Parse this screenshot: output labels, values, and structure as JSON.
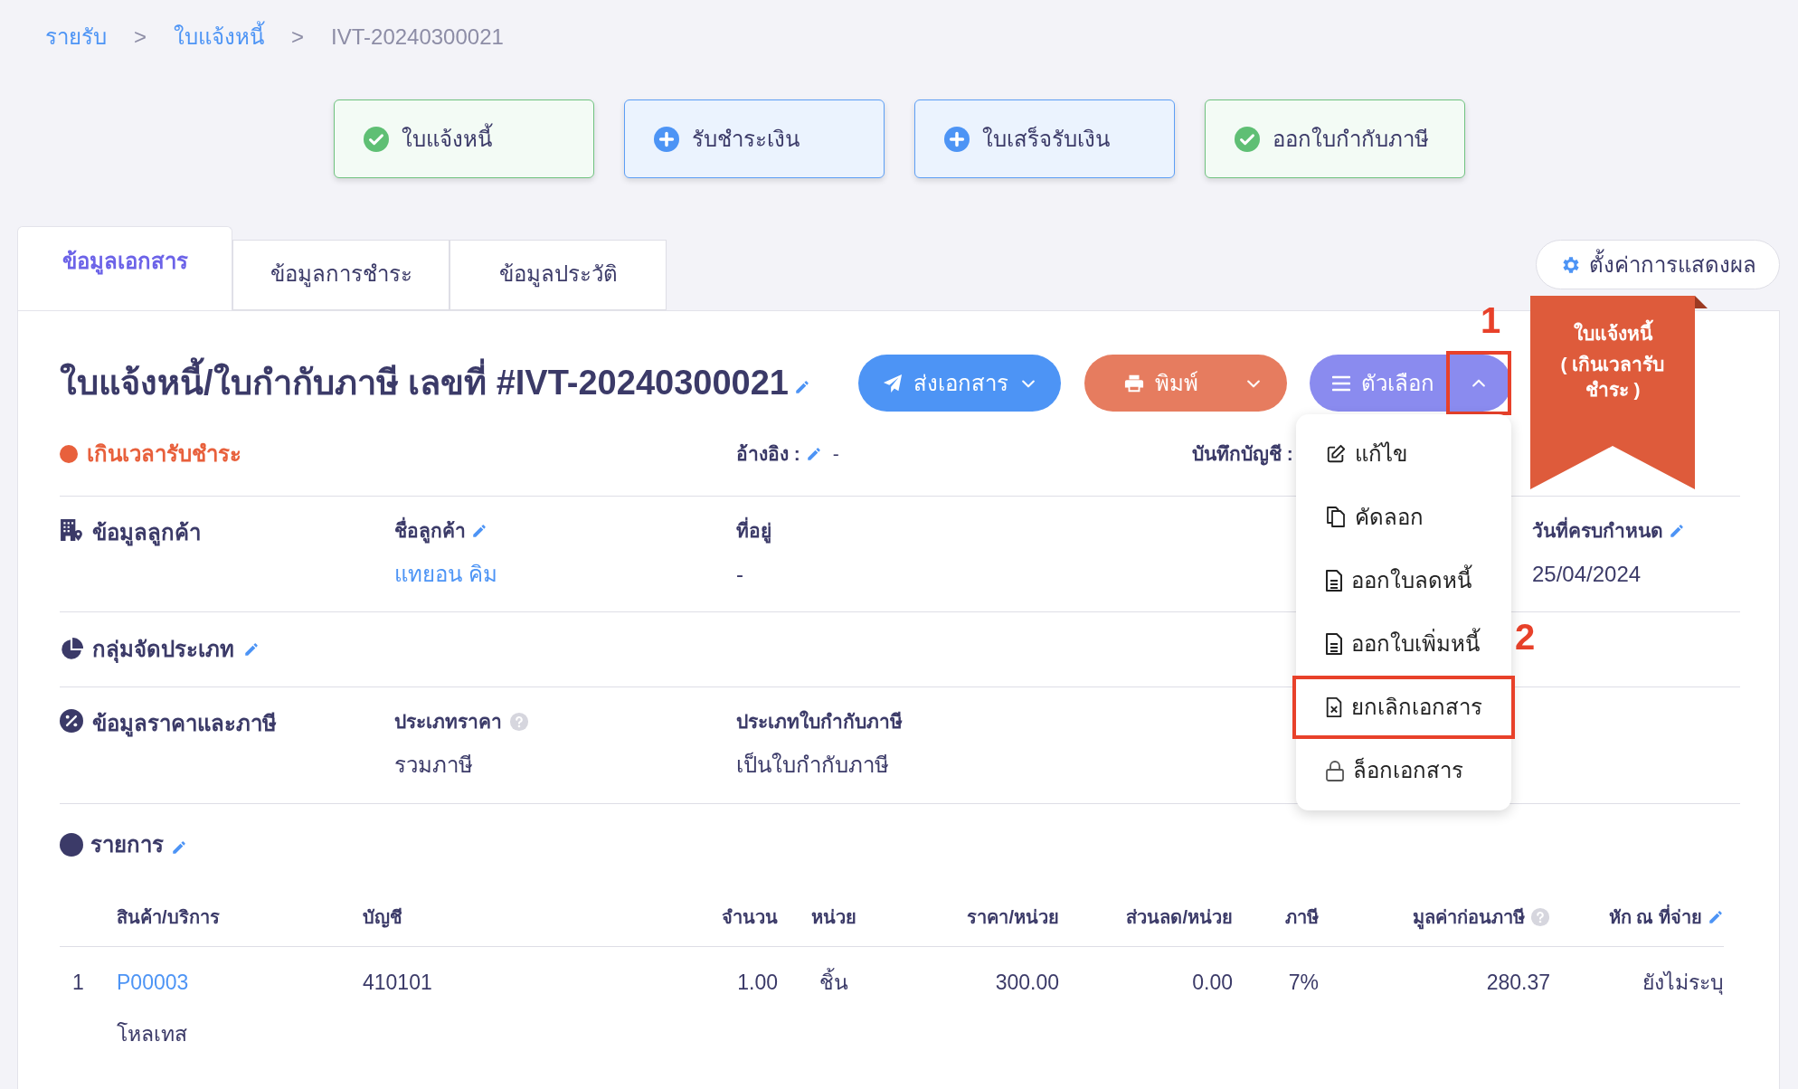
{
  "breadcrumb": [
    {
      "label": "รายรับ",
      "kind": "link"
    },
    {
      "label": ">",
      "kind": "separator"
    },
    {
      "label": "ใบแจ้งหนี้",
      "kind": "link"
    },
    {
      "label": ">",
      "kind": "separator"
    },
    {
      "label": "IVT-20240300021",
      "kind": "current"
    }
  ],
  "steps": [
    {
      "label": "ใบแจ้งหนี้",
      "done": true
    },
    {
      "label": "รับชำระเงิน",
      "done": false
    },
    {
      "label": "ใบเสร็จรับเงิน",
      "done": false
    },
    {
      "label": "ออกใบกำกับภาษี",
      "done": true
    }
  ],
  "tabs": [
    {
      "label": "ข้อมูลเอกสาร",
      "selected": true
    },
    {
      "label": "ข้อมูลการชำระ",
      "selected": false
    },
    {
      "label": "ข้อมูลประวัติ",
      "selected": false
    }
  ],
  "display_settings": "ตั้งค่าการแสดงผล",
  "ribbon": {
    "title": "ใบแจ้งหนี้",
    "subtitle": "( เกินเวลารับ ชำระ )"
  },
  "document": {
    "title": "ใบแจ้งหนี้/ใบกำกับภาษี เลขที่ #IVT-20240300021",
    "status": {
      "label": "เกินเวลารับชำระ",
      "color": "#e8603c"
    },
    "reference": {
      "label": "อ้างอิง :",
      "value": "-"
    },
    "account_record": {
      "label": "บันทึกบัญชี :"
    }
  },
  "actions": {
    "send": "ส่งเอกสาร",
    "print": "พิมพ์",
    "options": {
      "label": "ตัวเลือก",
      "expanded": true,
      "highlighted": true
    }
  },
  "options_menu": [
    {
      "label": "แก้ไข",
      "kind": "edit",
      "highlighted": false
    },
    {
      "label": "คัดลอก",
      "kind": "copy",
      "highlighted": false
    },
    {
      "label": "ออกใบลดหนี้",
      "kind": "document",
      "highlighted": false
    },
    {
      "label": "ออกใบเพิ่มหนี้",
      "kind": "document",
      "highlighted": false
    },
    {
      "label": "ยกเลิกเอกสาร",
      "kind": "cancel",
      "highlighted": true
    },
    {
      "label": "ล็อกเอกสาร",
      "kind": "lock",
      "highlighted": false
    }
  ],
  "annotations": [
    "1",
    "2"
  ],
  "customer": {
    "label": "ข้อมูลลูกค้า",
    "fields": [
      {
        "label": "ชื่อลูกค้า",
        "value": "แทยอน คิม",
        "editable": true,
        "link": true
      },
      {
        "label": "ที่อยู่",
        "value": "-",
        "link": false
      }
    ],
    "due_date": {
      "label": "วันที่ครบกำหนด",
      "value": "25/04/2024"
    }
  },
  "classification": {
    "label": "กลุ่มจัดประเภท"
  },
  "pricing": {
    "label": "ข้อมูลราคาและภาษี",
    "fields": [
      {
        "label": "ประเภทราคา",
        "value": "รวมภาษี",
        "help": true
      },
      {
        "label": "ประเภทใบกำกับภาษี",
        "value": "เป็นใบกำกับภาษี"
      }
    ]
  },
  "items": {
    "label": "รายการ",
    "columns": [
      {
        "label": "สินค้า/บริการ"
      },
      {
        "label": "บัญชี"
      },
      {
        "label": "จำนวน"
      },
      {
        "label": "หน่วย"
      },
      {
        "label": "ราคา/หน่วย"
      },
      {
        "label": "ส่วนลด/หน่วย"
      },
      {
        "label": "ภาษี"
      },
      {
        "label": "มูลค่าก่อนภาษี",
        "help": true
      },
      {
        "label": "หัก ณ ที่จ่าย",
        "editable": true
      }
    ],
    "rows": [
      {
        "index": "1",
        "product_code": "P00003",
        "description": "โหลเทส",
        "account": "410101",
        "quantity": "1.00",
        "unit": "ชิ้น",
        "price": "300.00",
        "discount": "0.00",
        "tax": "7%",
        "pretax": "280.37",
        "withholding": "ยังไม่ระบุ"
      }
    ]
  }
}
